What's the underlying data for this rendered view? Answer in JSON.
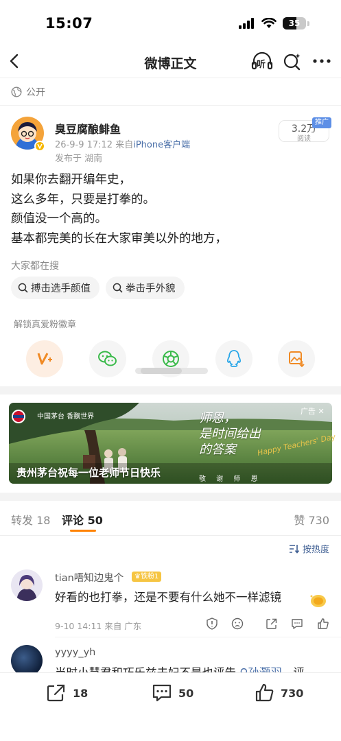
{
  "status_bar": {
    "time": "15:07",
    "battery": "35"
  },
  "nav": {
    "title": "微博正文",
    "listen_label": "听"
  },
  "visibility": {
    "label": "公开"
  },
  "post": {
    "author": "臭豆腐酿鲱鱼",
    "date": "26-9-9 17:12",
    "source_prefix": "来自",
    "source": "iPhone客户端",
    "location": "发布于 湖南",
    "read_count": "3.2万",
    "read_label": "阅读",
    "promo_tag": "推广",
    "lines": [
      "如果你去翻开编年史，",
      "这么多年，只要是打拳的。",
      "颜值没一个高的。",
      "基本都完美的长在大家审美以外的地方，"
    ]
  },
  "searches": {
    "label": "大家都在搜",
    "items": [
      "搏击选手颜值",
      "拳击手外貌"
    ]
  },
  "share": {
    "badge_label": "解锁真爱粉徽章"
  },
  "ad": {
    "caption": "贵州茅台祝每一位老师节日快乐",
    "tag": "广告 ✕",
    "slogan_1": "师恩，",
    "slogan_2": "是时间给出",
    "slogan_3": "的答案",
    "brand": "中国茅台 香飘世界",
    "teachers_day": "Happy Teachers' Day",
    "sub": "敬 谢 师 恩"
  },
  "tabs": {
    "repost_label": "转发",
    "repost_count": "18",
    "comments_label": "评论",
    "comments_count": "50",
    "likes_label": "赞",
    "likes_count": "730",
    "sort_label": "按热度"
  },
  "comments": [
    {
      "name": "tian唔知边鬼个",
      "fan_badge": "铁粉1",
      "text": "好看的也打拳，还是不要有什么她不一样滤镜",
      "meta": "9-10 14:11 来自 广东"
    },
    {
      "name": "yyyy_yh",
      "text_before": "当时小慧君和巧乐兹夫妇不是也评告",
      "mention": "孙灏羽",
      "text_after": "，评"
    }
  ],
  "bottom_bar": {
    "repost": "18",
    "comment": "50",
    "like": "730"
  },
  "colors": {
    "accent": "#ff8200",
    "link": "#4a6fa8",
    "promo": "#5d8fe6"
  }
}
